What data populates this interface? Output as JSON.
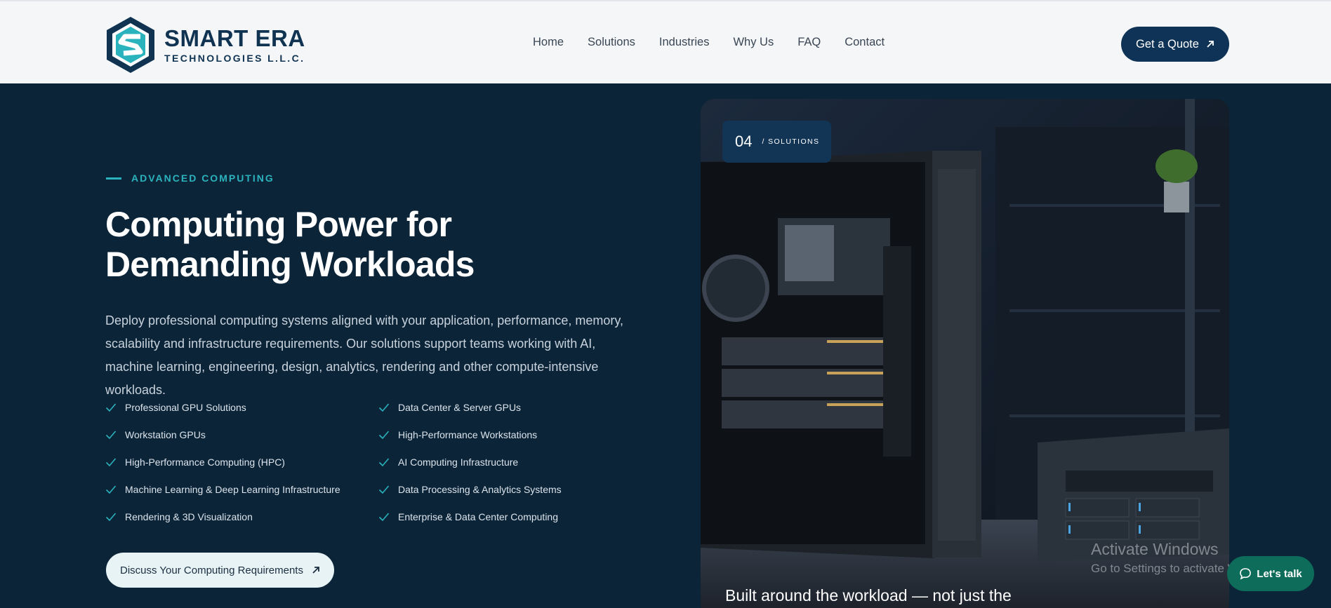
{
  "brand": {
    "name": "SMART ERA",
    "sub": "TECHNOLOGIES L.L.C.",
    "colors": {
      "navy": "#103352",
      "teal": "#2bb3bd"
    }
  },
  "nav": {
    "items": [
      {
        "label": "Home"
      },
      {
        "label": "Solutions"
      },
      {
        "label": "Industries"
      },
      {
        "label": "Why Us"
      },
      {
        "label": "FAQ"
      },
      {
        "label": "Contact"
      }
    ],
    "cta_label": "Get a Quote",
    "cta_icon": "arrow-up-right-icon"
  },
  "hero": {
    "eyebrow": "ADVANCED COMPUTING",
    "title_line1": "Computing Power for",
    "title_line2": "Demanding Workloads",
    "description": "Deploy professional computing systems aligned with your application, performance, memory, scalability and infrastructure requirements. Our solutions support teams working with AI, machine learning, engineering, design, analytics, rendering and other compute-intensive workloads.",
    "features": [
      "Professional GPU Solutions",
      "Data Center & Server GPUs",
      "Workstation GPUs",
      "High-Performance Workstations",
      "High-Performance Computing (HPC)",
      "AI Computing Infrastructure",
      "Machine Learning & Deep Learning Infrastructure",
      "Data Processing & Analytics Systems",
      "Rendering & 3D Visualization",
      "Enterprise & Data Center Computing"
    ],
    "cta_label": "Discuss Your Computing Requirements",
    "cta_icon": "arrow-up-right-icon"
  },
  "image_card": {
    "badge_number": "04",
    "badge_label": "/ SOLUTIONS",
    "caption": "Built around the workload — not just the"
  },
  "windows_watermark": {
    "line1": "Activate Windows",
    "line2": "Go to Settings to activate Windows."
  },
  "chat": {
    "label": "Let's talk",
    "icon": "chat-bubble-icon",
    "color": "#0e6d5a"
  }
}
